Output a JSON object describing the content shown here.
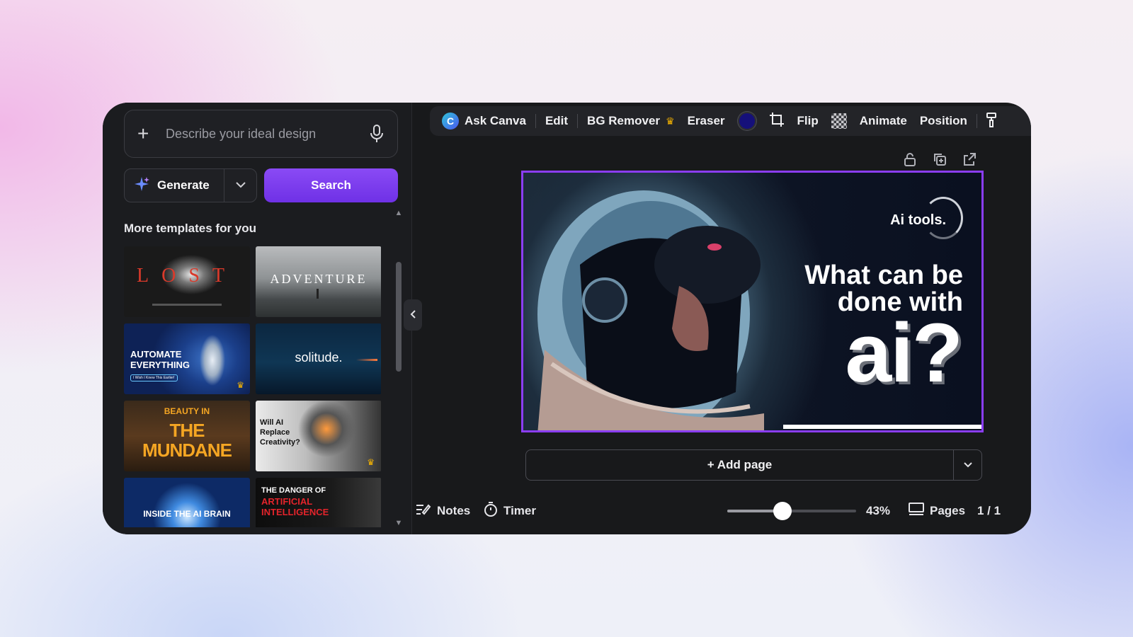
{
  "prompt": {
    "placeholder": "Describe your ideal design",
    "plus_icon": "plus-icon",
    "mic_icon": "microphone-icon"
  },
  "actions": {
    "generate_label": "Generate",
    "search_label": "Search"
  },
  "templates": {
    "section_title": "More templates for you",
    "items": [
      {
        "title": "LOST",
        "crown": false
      },
      {
        "title": "ADVENTURE",
        "crown": false
      },
      {
        "title": "AUTOMATE EVERYTHING",
        "badge": "I Wish I Knew This Earlier!",
        "crown": true
      },
      {
        "title": "solitude.",
        "crown": false
      },
      {
        "title_top": "BEAUTY IN",
        "title": "THE MUNDANE",
        "crown": false
      },
      {
        "title": "Will AI Replace Creativity?",
        "crown": true
      },
      {
        "title": "INSIDE THE AI BRAIN",
        "crown": false
      },
      {
        "title_top": "THE DANGER OF",
        "title": "ARTIFICIAL INTELLIGENCE",
        "crown": false
      }
    ]
  },
  "toolbar": {
    "ask_canva": "Ask Canva",
    "edit": "Edit",
    "bg_remover": "BG Remover",
    "eraser": "Eraser",
    "flip": "Flip",
    "animate": "Animate",
    "position": "Position",
    "color_value": "#15107a"
  },
  "slide": {
    "tag": "Ai tools.",
    "headline_line1": "What can be",
    "headline_line2": "done with",
    "big_text": "ai?"
  },
  "add_page": {
    "label": "+ Add page"
  },
  "bottom": {
    "notes": "Notes",
    "timer": "Timer",
    "zoom": "43%",
    "zoom_fraction": 0.43,
    "pages_label": "Pages",
    "page_count": "1 / 1"
  }
}
